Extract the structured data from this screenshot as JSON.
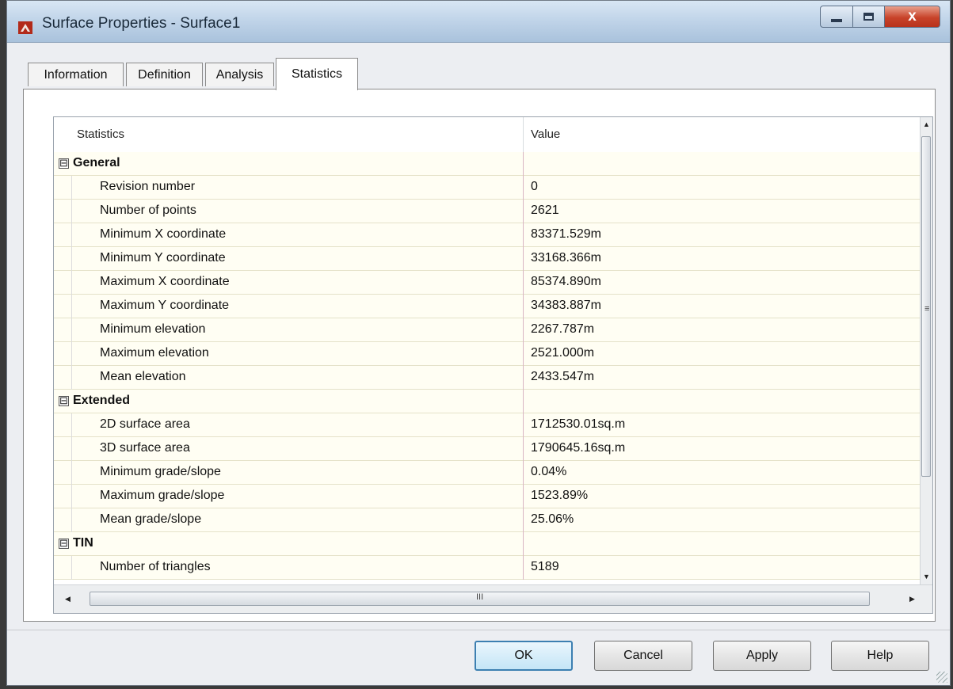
{
  "window": {
    "title": "Surface Properties - Surface1",
    "controls": {
      "minimize": "",
      "maximize": "",
      "close": "x"
    }
  },
  "tabs": [
    {
      "label": "Information"
    },
    {
      "label": "Definition"
    },
    {
      "label": "Analysis"
    },
    {
      "label": "Statistics",
      "active": true
    }
  ],
  "grid": {
    "headers": {
      "name": "Statistics",
      "value": "Value"
    },
    "groups": [
      {
        "label": "General",
        "expander": "⊟",
        "rows": [
          {
            "name": "Revision number",
            "value": "0"
          },
          {
            "name": "Number of points",
            "value": "2621"
          },
          {
            "name": "Minimum X coordinate",
            "value": "83371.529m"
          },
          {
            "name": "Minimum Y coordinate",
            "value": "33168.366m"
          },
          {
            "name": "Maximum X coordinate",
            "value": "85374.890m"
          },
          {
            "name": "Maximum Y coordinate",
            "value": "34383.887m"
          },
          {
            "name": "Minimum elevation",
            "value": "2267.787m"
          },
          {
            "name": "Maximum elevation",
            "value": "2521.000m"
          },
          {
            "name": "Mean elevation",
            "value": "2433.547m"
          }
        ]
      },
      {
        "label": "Extended",
        "expander": "⊟",
        "rows": [
          {
            "name": "2D surface area",
            "value": "1712530.01sq.m"
          },
          {
            "name": "3D surface area",
            "value": "1790645.16sq.m"
          },
          {
            "name": "Minimum grade/slope",
            "value": "0.04%"
          },
          {
            "name": "Maximum grade/slope",
            "value": "1523.89%"
          },
          {
            "name": "Mean grade/slope",
            "value": "25.06%"
          }
        ]
      },
      {
        "label": "TIN",
        "expander": "⊟",
        "rows": [
          {
            "name": "Number of triangles",
            "value": "5189"
          }
        ]
      }
    ]
  },
  "buttons": {
    "ok": "OK",
    "cancel": "Cancel",
    "apply": "Apply",
    "help": "Help"
  },
  "colors": {
    "row_bg": "#fffef3",
    "accent": "#3c7fb1",
    "close": "#c8432a"
  },
  "icons": {
    "app": "autodesk-app-icon",
    "scroll_up": "▲",
    "scroll_down": "▼",
    "scroll_left": "◀",
    "scroll_right": "▶",
    "v_grip": "≡",
    "h_grip": "III"
  }
}
